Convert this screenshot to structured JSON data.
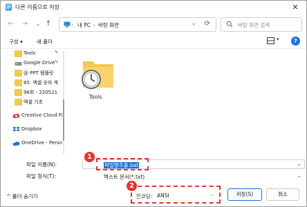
{
  "window": {
    "title": "다른 이름으로 저장",
    "close_glyph": "✕"
  },
  "address": {
    "segments": [
      "내 PC",
      "바탕 화면"
    ],
    "separator": "›",
    "search_placeholder": "바탕 화면 검색"
  },
  "toolbar": {
    "organize_label": "구성 ▾",
    "new_folder_label": "새 폴더"
  },
  "nav": {
    "items": [
      {
        "label": "Tools",
        "icon": "folder-icon",
        "pinned": true
      },
      {
        "label": "Google Drive",
        "icon": "google-drive-icon",
        "pinned": true
      },
      {
        "label": "@ PPT 템플릿",
        "icon": "folder-icon"
      },
      {
        "label": "85. 엑셀 숫자 계",
        "icon": "folder-icon"
      },
      {
        "label": "96회 - 220521",
        "icon": "folder-icon"
      },
      {
        "label": "엑셀 기초",
        "icon": "folder-icon"
      },
      {
        "label": "Creative Cloud Fi",
        "icon": "creative-cloud-icon"
      },
      {
        "label": "Dropbox",
        "icon": "dropbox-icon"
      },
      {
        "label": "OneDrive - Perso",
        "icon": "onedrive-icon"
      }
    ]
  },
  "content": {
    "files": [
      {
        "name": "Tools",
        "icon": "folder-with-clock-icon"
      }
    ]
  },
  "fields": {
    "filename_label": "파일 이름(N):",
    "filename_value": "파일명추출.bat",
    "filetype_label": "파일 형식(T):",
    "filetype_value": "텍스트 문서(*.txt)"
  },
  "footer": {
    "hide_folders_label": "^ 폴더 숨기기",
    "encoding_label": "인코딩:",
    "encoding_value": "ANSI",
    "save_label": "저장(S)",
    "cancel_label": "취소"
  },
  "annotations": {
    "badge_1": "1",
    "badge_2": "2"
  },
  "colors": {
    "accent": "#1a6ce0",
    "highlight": "#e8312a",
    "folder": "#f4c74d"
  }
}
